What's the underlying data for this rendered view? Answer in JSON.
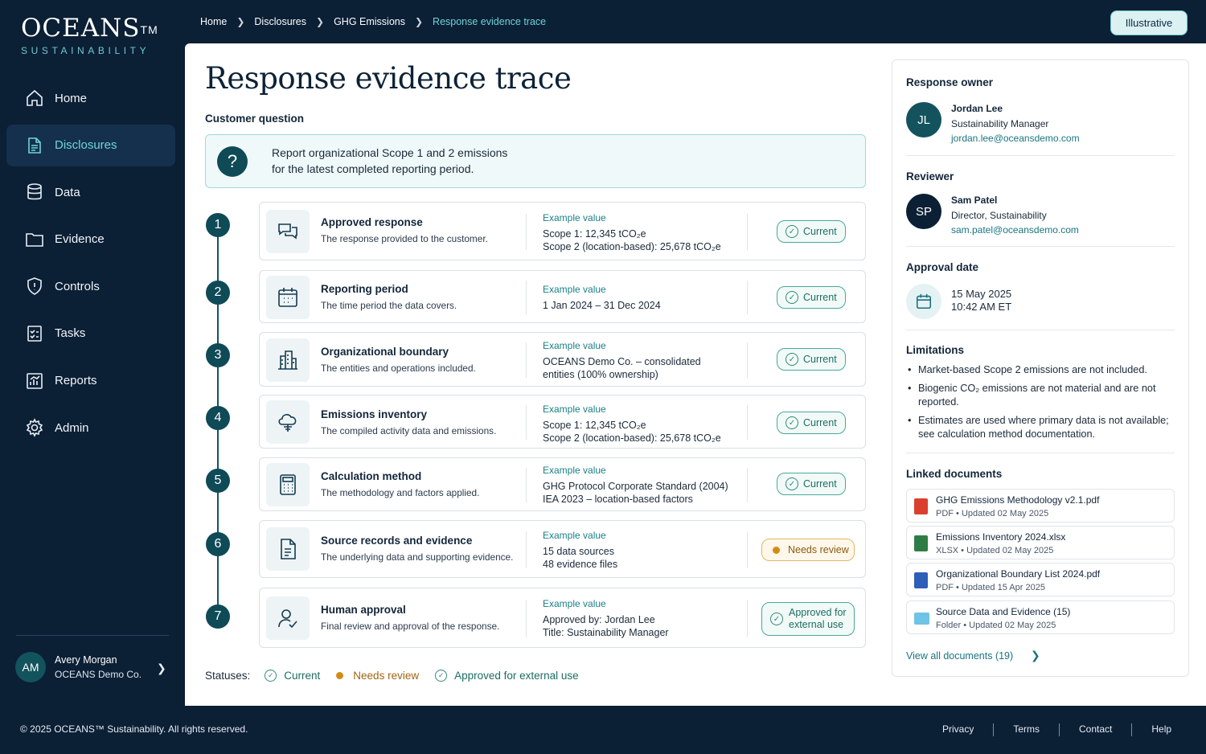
{
  "brand": {
    "name": "OCEANS",
    "tm": "TM",
    "tagline": "SUSTAINABILITY"
  },
  "nav": [
    {
      "label": "Home",
      "icon": "home-icon"
    },
    {
      "label": "Disclosures",
      "icon": "document-icon",
      "active": true
    },
    {
      "label": "Data",
      "icon": "database-icon"
    },
    {
      "label": "Evidence",
      "icon": "folder-icon"
    },
    {
      "label": "Controls",
      "icon": "shield-icon"
    },
    {
      "label": "Tasks",
      "icon": "checklist-icon"
    },
    {
      "label": "Reports",
      "icon": "chart-icon"
    },
    {
      "label": "Admin",
      "icon": "gear-icon"
    }
  ],
  "user": {
    "initials": "AM",
    "name": "Avery Morgan",
    "org": "OCEANS Demo Co."
  },
  "breadcrumb": [
    "Home",
    "Disclosures",
    "GHG Emissions",
    "Response evidence trace"
  ],
  "badge": "Illustrative",
  "page": {
    "title": "Response evidence trace",
    "question_label": "Customer question",
    "question_line1": "Report organizational Scope 1 and 2 emissions",
    "question_line2": "for the latest completed reporting period."
  },
  "steps": [
    {
      "num": "1",
      "title": "Approved response",
      "desc": "The response provided to the customer.",
      "example_label": "Example value",
      "line1": "Scope 1: 12,345 tCO₂e",
      "line2": "Scope 2 (location-based): 25,678 tCO₂e",
      "status": "Current"
    },
    {
      "num": "2",
      "title": "Reporting period",
      "desc": "The time period the data covers.",
      "example_label": "Example value",
      "line1": "1 Jan 2024 – 31 Dec 2024",
      "line2": "",
      "status": "Current"
    },
    {
      "num": "3",
      "title": "Organizational boundary",
      "desc": "The entities and operations included.",
      "example_label": "Example value",
      "line1": "OCEANS Demo Co. – consolidated",
      "line2": "entities (100% ownership)",
      "status": "Current"
    },
    {
      "num": "4",
      "title": "Emissions inventory",
      "desc": "The compiled activity data and emissions.",
      "example_label": "Example value",
      "line1": "Scope 1: 12,345 tCO₂e",
      "line2": "Scope 2 (location-based): 25,678 tCO₂e",
      "status": "Current"
    },
    {
      "num": "5",
      "title": "Calculation method",
      "desc": "The methodology and factors applied.",
      "example_label": "Example value",
      "line1": "GHG Protocol Corporate Standard (2004)",
      "line2": "IEA 2023 – location-based factors",
      "status": "Current"
    },
    {
      "num": "6",
      "title": "Source records and evidence",
      "desc": "The underlying data and supporting evidence.",
      "example_label": "Example value",
      "line1": "15 data sources",
      "line2": "48 evidence files",
      "status": "Needs review"
    },
    {
      "num": "7",
      "title": "Human approval",
      "desc": "Final review and approval of the response.",
      "example_label": "Example value",
      "line1": "Approved by: Jordan Lee",
      "line2": "Title: Sustainability Manager",
      "status_line1": "Approved for",
      "status_line2": "external use"
    }
  ],
  "legend": {
    "label": "Statuses:",
    "current": "Current",
    "needs_review": "Needs review",
    "approved": "Approved for external use"
  },
  "right": {
    "owner_head": "Response owner",
    "owner": {
      "initials": "JL",
      "name": "Jordan Lee",
      "title": "Sustainability Manager",
      "email": "jordan.lee@oceansdemo.com"
    },
    "reviewer_head": "Reviewer",
    "reviewer": {
      "initials": "SP",
      "name": "Sam Patel",
      "title": "Director, Sustainability",
      "email": "sam.patel@oceansdemo.com"
    },
    "approval_head": "Approval date",
    "approval_date": "15 May 2025",
    "approval_time": "10:42 AM ET",
    "limitations_head": "Limitations",
    "limitations": [
      "Market-based Scope 2 emissions are not included.",
      "Biogenic CO₂ emissions are not material and are not reported.",
      "Estimates are used where primary data is not available; see calculation method documentation."
    ],
    "docs_head": "Linked documents",
    "docs": [
      {
        "name": "GHG Emissions Methodology v2.1.pdf",
        "meta": "PDF  •  Updated 02 May 2025",
        "color": "#d9412e"
      },
      {
        "name": "Emissions Inventory 2024.xlsx",
        "meta": "XLSX  •  Updated 02 May 2025",
        "color": "#2f7d46"
      },
      {
        "name": "Organizational Boundary List 2024.pdf",
        "meta": "PDF  •  Updated 15 Apr 2025",
        "color": "#2d5fb8"
      },
      {
        "name": "Source Data and Evidence (15)",
        "meta": "Folder  •  Updated 02 May 2025",
        "color": "#6ec3e6"
      }
    ],
    "view_all": "View all documents (19)"
  },
  "footer": {
    "copyright": "© 2025 OCEANS™ Sustainability. All rights reserved.",
    "links": [
      "Privacy",
      "Terms",
      "Contact",
      "Help"
    ]
  }
}
